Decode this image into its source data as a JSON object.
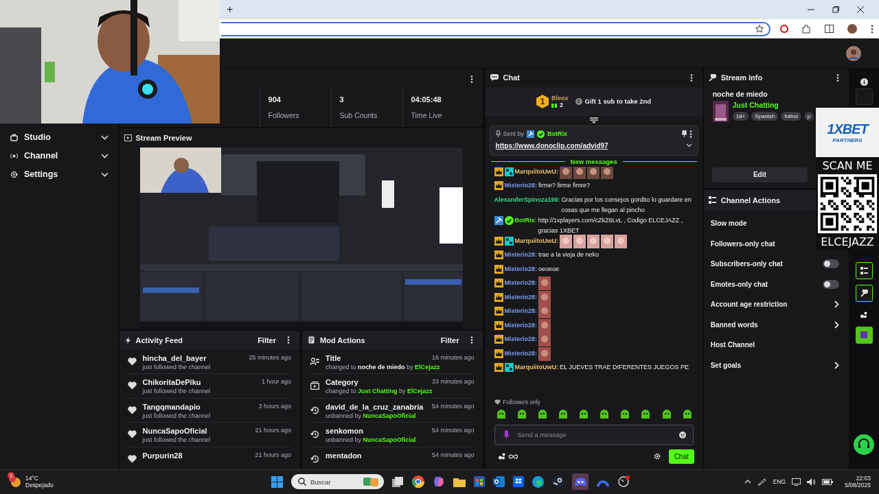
{
  "browser": {
    "new_tab": "+"
  },
  "sidebar": {
    "items": [
      {
        "label": "Studio",
        "expanded": false
      },
      {
        "label": "Channel",
        "expanded": false
      },
      {
        "label": "Settings",
        "expanded": false
      }
    ]
  },
  "stats": [
    {
      "value": "904",
      "label": "Followers"
    },
    {
      "value": "3",
      "label": "Sub Counts"
    },
    {
      "value": "04:05:48",
      "label": "Time Live"
    }
  ],
  "stream_preview": {
    "title": "Stream Preview",
    "kind": "picture"
  },
  "activity_feed": {
    "title": "Activity Feed",
    "filter": "Filter",
    "items": [
      {
        "name": "hincha_del_bayer",
        "detail": "just followed the channel",
        "time": "25 minutes ago"
      },
      {
        "name": "ChikoritaDePiku",
        "detail": "just followed the channel",
        "time": "1 hour ago"
      },
      {
        "name": "Tangqmandapio",
        "detail": "just followed the channel",
        "time": "3 hours ago"
      },
      {
        "name": "NuncaSapoOficial",
        "detail": "just followed the channel",
        "time": "21 hours ago"
      },
      {
        "name": "Purpurin28",
        "time": "21 hours ago"
      }
    ]
  },
  "mod_actions": {
    "title": "Mod Actions",
    "filter": "Filter",
    "items": [
      {
        "kind": "title",
        "target": "Title",
        "time": "16 minutes ago",
        "action": "changed to",
        "value": "noche de miedo",
        "by_label": "by",
        "by": "ElCejazz"
      },
      {
        "kind": "category",
        "target": "Category",
        "time": "33 minutes ago",
        "action": "changed to",
        "value": "Just Chatting",
        "by_label": "by",
        "by": "ElCejazz"
      },
      {
        "kind": "unban",
        "target": "david_de_la_cruz_zanabria",
        "time": "54 minutes ago",
        "action": "unbanned by",
        "by": "NuncaSapoOficial"
      },
      {
        "kind": "unban",
        "target": "senkomon",
        "time": "54 minutes ago",
        "action": "unbanned by",
        "by": "NuncaSapoOficial"
      },
      {
        "kind": "unban",
        "target": "mentadon",
        "time": "54 minutes ago"
      }
    ]
  },
  "chat": {
    "title": "Chat",
    "leader": {
      "rank": "1",
      "name": "Bleox",
      "count": "2",
      "gift_rank": "2",
      "gift_text": "Gift 1 sub to take 2nd"
    },
    "pinned": {
      "label": "Sent by",
      "user": "BotRix",
      "link": "https://www.donoclip.com/advid97"
    },
    "divider": "New messages",
    "messages": [
      {
        "user": "MarquiitoUwU:",
        "color": "#e8c16a",
        "badges": [
          {
            "kind": "crown"
          },
          {
            "kind": "ag"
          }
        ],
        "emotes": [
          {
            "kind": "portrait"
          },
          {
            "kind": "portrait"
          },
          {
            "kind": "portrait"
          },
          {
            "kind": "portrait"
          }
        ]
      },
      {
        "user": "Misterio28:",
        "color": "#7b9cf0",
        "badges": [
          {
            "kind": "crown"
          }
        ],
        "text": "firme? firme fimre?"
      },
      {
        "user": "AlexanderSpinoza199:",
        "color": "#3fd68a",
        "text": "Gracias por los consejos gordito lo guardare en cosas que me llegan al pincho"
      },
      {
        "user": "BotRix:",
        "color": "#53fc18",
        "badges": [
          {
            "kind": "hammer"
          },
          {
            "kind": "verified"
          }
        ],
        "text": "http://1xplayers.com/cZkZ6LvL , Codigo ELCEJAZZ , gracias 1XBET"
      },
      {
        "user": "MarquiitoUwU:",
        "color": "#e8c16a",
        "badges": [
          {
            "kind": "crown"
          },
          {
            "kind": "ag"
          }
        ],
        "emotes": [
          {
            "kind": "pig"
          },
          {
            "kind": "pig"
          },
          {
            "kind": "pig"
          },
          {
            "kind": "pig"
          },
          {
            "kind": "pig"
          }
        ]
      },
      {
        "user": "Misterio28:",
        "color": "#7b9cf0",
        "badges": [
          {
            "kind": "crown"
          }
        ],
        "text": "trae a la vieja de neko"
      },
      {
        "user": "Misterio28:",
        "color": "#7b9cf0",
        "badges": [
          {
            "kind": "crown"
          }
        ],
        "text": "oeoeoe"
      },
      {
        "user": "Misterio28:",
        "color": "#7b9cf0",
        "badges": [
          {
            "kind": "crown"
          }
        ],
        "emotes": [
          {
            "kind": "face"
          }
        ]
      },
      {
        "user": "Misterio28:",
        "color": "#7b9cf0",
        "badges": [
          {
            "kind": "crown"
          }
        ],
        "emotes": [
          {
            "kind": "face"
          }
        ]
      },
      {
        "user": "Misterio28:",
        "color": "#7b9cf0",
        "badges": [
          {
            "kind": "crown"
          }
        ],
        "emotes": [
          {
            "kind": "face"
          }
        ]
      },
      {
        "user": "Misterio28:",
        "color": "#7b9cf0",
        "badges": [
          {
            "kind": "crown"
          }
        ],
        "emotes": [
          {
            "kind": "face"
          }
        ]
      },
      {
        "user": "Misterio28:",
        "color": "#7b9cf0",
        "badges": [
          {
            "kind": "crown"
          }
        ],
        "emotes": [
          {
            "kind": "face"
          }
        ]
      },
      {
        "user": "Misterio28:",
        "color": "#7b9cf0",
        "badges": [
          {
            "kind": "crown"
          }
        ],
        "emotes": [
          {
            "kind": "face"
          }
        ]
      },
      {
        "user": "MarquiitoUwU:",
        "color": "#e8c16a",
        "badges": [
          {
            "kind": "crown"
          },
          {
            "kind": "ag"
          }
        ],
        "text": "EL JUEVES TRAE DIFERENTES JUEGOS PE"
      }
    ],
    "followers_only": "Followers only",
    "placeholder": "Send a message",
    "send": "Chat"
  },
  "stream_info": {
    "title": "Stream info",
    "stream_title": "noche de miedo",
    "category": "Just Chatting",
    "tags": [
      "18+",
      "Spanish",
      "futbol",
      "p"
    ],
    "edit": "Edit"
  },
  "channel_actions": {
    "title": "Channel Actions",
    "items": [
      {
        "label": "Slow mode",
        "kind": "plain"
      },
      {
        "label": "Followers-only chat",
        "kind": "plain"
      },
      {
        "label": "Subscribers-only chat",
        "kind": "toggle",
        "on": false
      },
      {
        "label": "Emotes-only chat",
        "kind": "toggle",
        "on": false
      },
      {
        "label": "Account age restriction",
        "kind": "link"
      },
      {
        "label": "Banned words",
        "kind": "link"
      },
      {
        "label": "Host Channel",
        "kind": "plain"
      },
      {
        "label": "Set goals",
        "kind": "link"
      }
    ]
  },
  "qr_overlay": {
    "brand": "1XBET",
    "brand_sub": "PARTNERS",
    "top": "SCAN ME",
    "bottom": "ELCEJAZZ"
  },
  "taskbar": {
    "weather_badge": "3",
    "temp": "14°C",
    "weather": "Despejado",
    "search": "Buscar",
    "lang": "ENG",
    "time": "22:03",
    "date": "5/08/2025"
  }
}
